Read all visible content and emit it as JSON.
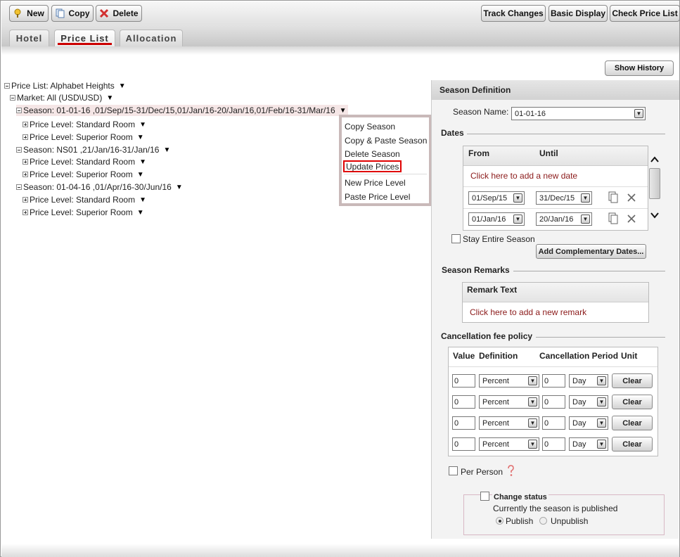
{
  "toolbar": {
    "new_label": "New",
    "copy_label": "Copy",
    "delete_label": "Delete",
    "track_label": "Track Changes",
    "basic_label": "Basic Display",
    "check_label": "Check Price List"
  },
  "tabs": {
    "hotel": "Hotel",
    "price_list": "Price List",
    "allocation": "Allocation"
  },
  "show_history": "Show History",
  "tree": {
    "root": "Price List: Alphabet Heights",
    "market": "Market: All (USD\\USD)",
    "seasons": [
      {
        "label": "Season: 01-01-16 ,01/Sep/15-31/Dec/15,01/Jan/16-20/Jan/16,01/Feb/16-31/Mar/16",
        "levels": [
          "Price Level: Standard Room",
          "Price Level: Superior Room"
        ]
      },
      {
        "label": "Season: NS01 ,21/Jan/16-31/Jan/16",
        "levels": [
          "Price Level: Standard Room",
          "Price Level: Superior Room"
        ]
      },
      {
        "label": "Season: 01-04-16 ,01/Apr/16-30/Jun/16",
        "levels": [
          "Price Level: Standard Room",
          "Price Level: Superior Room"
        ]
      }
    ]
  },
  "context_menu": [
    "Copy Season",
    "Copy & Paste Season",
    "Delete Season",
    "Update Prices",
    "New Price Level",
    "Paste Price Level"
  ],
  "season_def": {
    "title": "Season Definition",
    "name_label": "Season Name:",
    "name_value": "01-01-16",
    "dates_title": "Dates",
    "from_header": "From",
    "until_header": "Until",
    "add_date": "Click here to add a new date",
    "date_rows": [
      {
        "from": "01/Sep/15",
        "until": "31/Dec/15"
      },
      {
        "from": "01/Jan/16",
        "until": "20/Jan/16"
      }
    ],
    "stay_entire": "Stay Entire Season",
    "add_complementary": "Add Complementary Dates...",
    "remarks_title": "Season Remarks",
    "remark_header": "Remark Text",
    "add_remark": "Click here to add a new remark",
    "cancel_title": "Cancellation fee policy",
    "cancel_headers": {
      "value": "Value",
      "definition": "Definition",
      "period": "Cancellation Period",
      "unit": "Unit"
    },
    "cancel_rows": [
      {
        "value": "0",
        "definition": "Percent",
        "period": "0",
        "unit": "Day",
        "clear": "Clear"
      },
      {
        "value": "0",
        "definition": "Percent",
        "period": "0",
        "unit": "Day",
        "clear": "Clear"
      },
      {
        "value": "0",
        "definition": "Percent",
        "period": "0",
        "unit": "Day",
        "clear": "Clear"
      },
      {
        "value": "0",
        "definition": "Percent",
        "period": "0",
        "unit": "Day",
        "clear": "Clear"
      }
    ],
    "per_person": "Per Person",
    "change_status": "Change status",
    "status_text": "Currently the season is published",
    "publish": "Publish",
    "unpublish": "Unpublish"
  }
}
